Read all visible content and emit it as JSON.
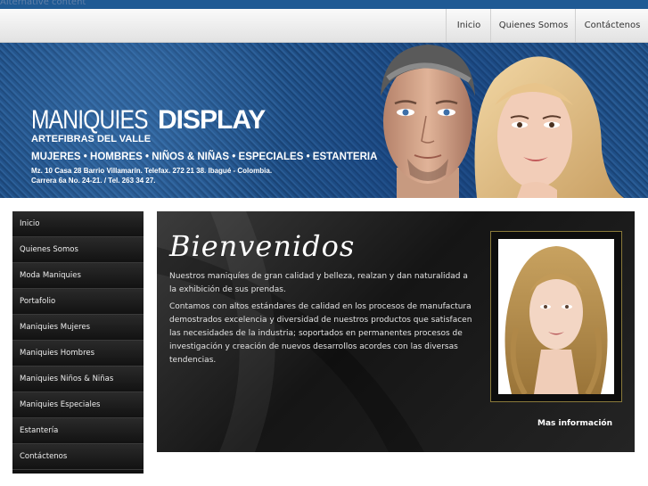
{
  "alt_text": "Alternative content",
  "nav": {
    "items": [
      {
        "label": "Inicio"
      },
      {
        "label": "Quienes Somos"
      },
      {
        "label": "Contáctenos"
      }
    ]
  },
  "banner": {
    "brand_thin": "MANIQUIES",
    "brand_bold": "DISPLAY",
    "company": "ARTEFIBRAS DEL VALLE",
    "categories": "MUJERES  •  HOMBRES  •  NIÑOS & NIÑAS   •  ESPECIALES  •  ESTANTERIA",
    "address_line1": "Mz. 10 Casa 28 Barrio Villamarín. Telefax. 272 21 38. Ibagué - Colombia.",
    "address_line2": "Carrera 6a No. 24-21. / Tel. 263 34 27."
  },
  "sidebar": {
    "items": [
      {
        "label": "Inicio"
      },
      {
        "label": "Quienes Somos"
      },
      {
        "label": "Moda Maniquies"
      },
      {
        "label": "Portafolio"
      },
      {
        "label": "Maniquies Mujeres"
      },
      {
        "label": "Maniquies Hombres"
      },
      {
        "label": "Maniquies Niños & Niñas"
      },
      {
        "label": "Maniquies Especiales"
      },
      {
        "label": "Estantería"
      },
      {
        "label": "Contáctenos"
      }
    ]
  },
  "main": {
    "heading": "Bienvenidos",
    "paragraph1": "Nuestros maniquíes de gran calidad y belleza, realzan y dan naturalidad a la exhibición de sus prendas.",
    "paragraph2": "Contamos con altos estándares de calidad en los procesos de manufactura demostrados excelencia y diversidad de nuestros productos que satisfacen las necesidades de la industria; soportados en permanentes procesos de investigación y creación de nuevos desarrollos acordes con las diversas tendencias.",
    "more_link": "Mas información"
  },
  "colors": {
    "topbar": "#1f5a94",
    "banner_blue": "#1f4f86",
    "panel_dark": "#151515",
    "frame_gold": "#8a7a3a"
  }
}
